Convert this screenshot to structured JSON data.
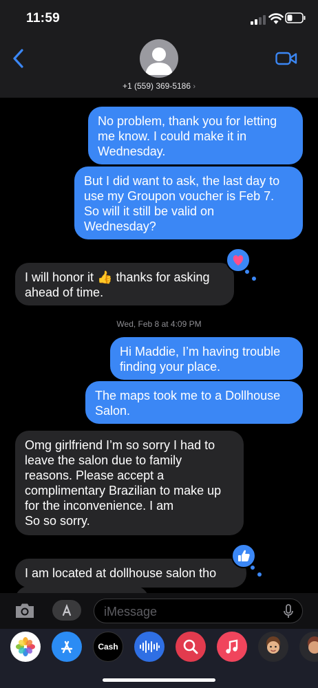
{
  "status": {
    "time": "11:59"
  },
  "header": {
    "contact": "+1 (559) 369-5186",
    "chevron": "›"
  },
  "messages": [
    {
      "dir": "out",
      "lines": [
        "No problem, thank you for letting",
        "me know. I could make it in",
        "Wednesday."
      ]
    },
    {
      "dir": "out",
      "lines": [
        "But I did want to ask, the last day to",
        "use my Groupon voucher is Feb 7.",
        "So will it still be valid on",
        "Wednesday?"
      ]
    },
    {
      "dir": "in",
      "lines": [
        "I will honor it 👍 thanks for asking",
        "ahead of time."
      ],
      "tapback": "heart-icon"
    },
    {
      "dir": "out",
      "lines": [
        "Hi Maddie, I’m having trouble",
        "finding your place."
      ]
    },
    {
      "dir": "out",
      "lines": [
        "The maps took me to a Dollhouse",
        "Salon."
      ]
    },
    {
      "dir": "in",
      "lines": [
        "Omg girlfriend I’m so sorry I had to",
        "leave the salon due to family",
        "reasons. Please accept a",
        "complimentary Brazilian to make up",
        "for the inconvenience. I am",
        "So so sorry."
      ]
    },
    {
      "dir": "in",
      "lines": [
        "I am located at dollhouse salon tho"
      ],
      "tapback": "thumbs-up-icon"
    }
  ],
  "timestamp": {
    "day": "Wed, Feb 8",
    "time": "at 4:09 PM"
  },
  "input": {
    "placeholder": "iMessage"
  },
  "tray": {
    "cash_label": "Cash"
  },
  "colors": {
    "outgoing": "#3b87f5",
    "incoming": "#262628",
    "header": "#1c1c1e",
    "background": "#000000"
  }
}
